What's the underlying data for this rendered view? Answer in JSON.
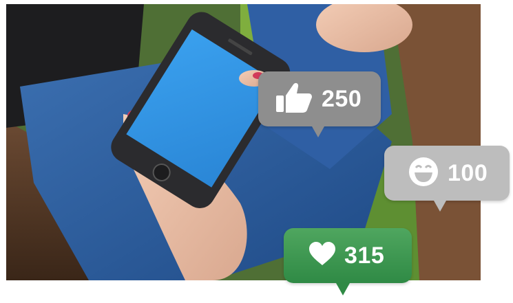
{
  "photo": {
    "subject": "woman-holding-smartphone"
  },
  "reactions": [
    {
      "icon": "thumbs-up-icon",
      "count": "250",
      "color": "#8e8e8e"
    },
    {
      "icon": "laughing-face-icon",
      "count": "100",
      "color": "#bdbdbd"
    },
    {
      "icon": "heart-icon",
      "count": "315",
      "color": "#3a9a50"
    }
  ]
}
